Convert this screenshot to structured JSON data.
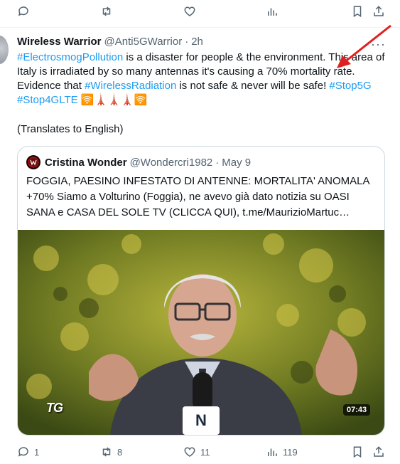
{
  "top_actions": {
    "reply_icon": "reply-icon",
    "retweet_icon": "retweet-icon",
    "like_icon": "heart-icon",
    "views_icon": "views-icon",
    "bookmark_icon": "bookmark-icon",
    "share_icon": "share-icon"
  },
  "tweet": {
    "author_name": "Wireless Warrior",
    "author_handle": "@Anti5GWarrior",
    "separator": "·",
    "time": "2h",
    "more": "···",
    "text_parts": [
      {
        "type": "tag",
        "text": "#ElectrosmogPollution"
      },
      {
        "type": "text",
        "text": " is a disaster for people & the environment. This area of Italy is irradiated by so many  antennas it's causing a 70% mortality rate. Evidence that  "
      },
      {
        "type": "tag",
        "text": "#WirelessRadiation"
      },
      {
        "type": "text",
        "text": " is not safe & never will be safe! "
      },
      {
        "type": "tag",
        "text": "#Stop5G"
      },
      {
        "type": "text",
        "text": " "
      },
      {
        "type": "tag",
        "text": "#Stop4GLTE"
      },
      {
        "type": "text",
        "text": " 🛜🗼🗼🗼🛜"
      }
    ],
    "translate": "(Translates to English)",
    "quoted": {
      "author_name": "Cristina Wonder",
      "author_handle": "@Wondercri1982",
      "separator": "·",
      "time": "May 9",
      "text": "FOGGIA, PAESINO INFESTATO DI ANTENNE: MORTALITA' ANOMALA +70% Siamo a Volturino (Foggia), ne avevo già dato notizia su OASI SANA e CASA DEL SOLE TV (CLICCA QUI),  t.me/MaurizioMartuc…",
      "media_logo": "TG",
      "mic_logo": "N",
      "video_duration": "07:43"
    },
    "stats": {
      "replies": "1",
      "retweets": "8",
      "likes": "11",
      "views": "119"
    }
  },
  "colors": {
    "accent": "#1d9bf0",
    "muted": "#536471",
    "annotation": "#e02020"
  }
}
